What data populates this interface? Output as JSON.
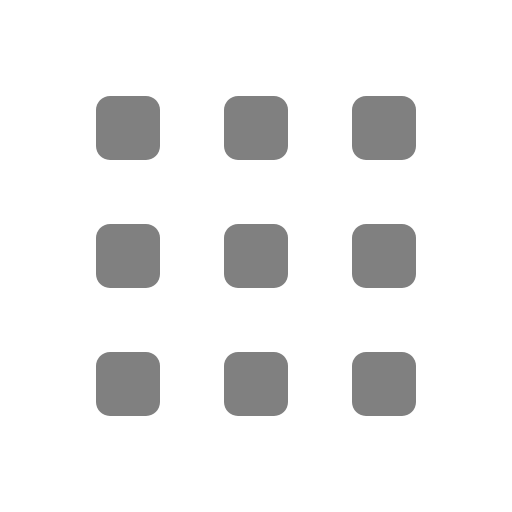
{
  "icon": {
    "name": "apps-grid-icon",
    "shape": "rounded-square",
    "rows": 3,
    "columns": 3,
    "color": "#808080"
  },
  "colors": {
    "background": "#ffffff",
    "glyph": "#808080"
  }
}
